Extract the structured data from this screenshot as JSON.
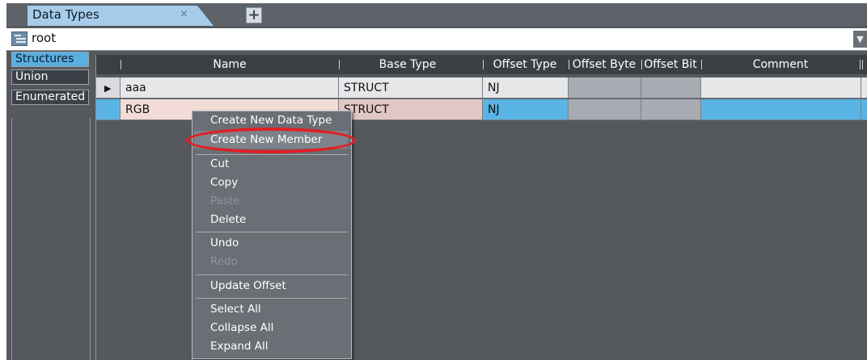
{
  "tab": {
    "title": "Data Types",
    "close_glyph": "×",
    "add_glyph": "+"
  },
  "path": {
    "value": "root",
    "dropdown_glyph": "▼"
  },
  "categories": [
    "Structures",
    "Union",
    "Enumerated"
  ],
  "grid": {
    "columns": [
      "Name",
      "Base Type",
      "Offset Type",
      "Offset Byte",
      "Offset Bit",
      "Comment"
    ],
    "rows": [
      {
        "name": "aaa",
        "base_type": "STRUCT",
        "offset_type": "NJ",
        "offset_byte": "",
        "offset_bit": "",
        "comment": ""
      },
      {
        "name": "RGB",
        "base_type": "STRUCT",
        "offset_type": "NJ",
        "offset_byte": "",
        "offset_bit": "",
        "comment": ""
      }
    ],
    "row_arrow_glyph": "▶"
  },
  "context_menu": {
    "items": [
      {
        "label": "Create New Data Type",
        "enabled": true
      },
      {
        "label": "Create New Member",
        "enabled": true
      },
      {
        "label": "Cut",
        "enabled": true
      },
      {
        "label": "Copy",
        "enabled": true
      },
      {
        "label": "Paste",
        "enabled": false
      },
      {
        "label": "Delete",
        "enabled": true
      },
      {
        "label": "Undo",
        "enabled": true
      },
      {
        "label": "Redo",
        "enabled": false
      },
      {
        "label": "Update Offset",
        "enabled": true
      },
      {
        "label": "Select All",
        "enabled": true
      },
      {
        "label": "Collapse All",
        "enabled": true
      },
      {
        "label": "Expand All",
        "enabled": true
      }
    ],
    "highlighted": "Create New Member"
  },
  "colors": {
    "tab": "#a6ccea",
    "selected_row": "#5ab4e5",
    "highlight_ring": "#e01f26",
    "panel_bg": "#55595e"
  },
  "icons": [
    "tree-icon",
    "close-icon",
    "plus-icon",
    "chevron-down-icon",
    "row-arrow-icon"
  ]
}
